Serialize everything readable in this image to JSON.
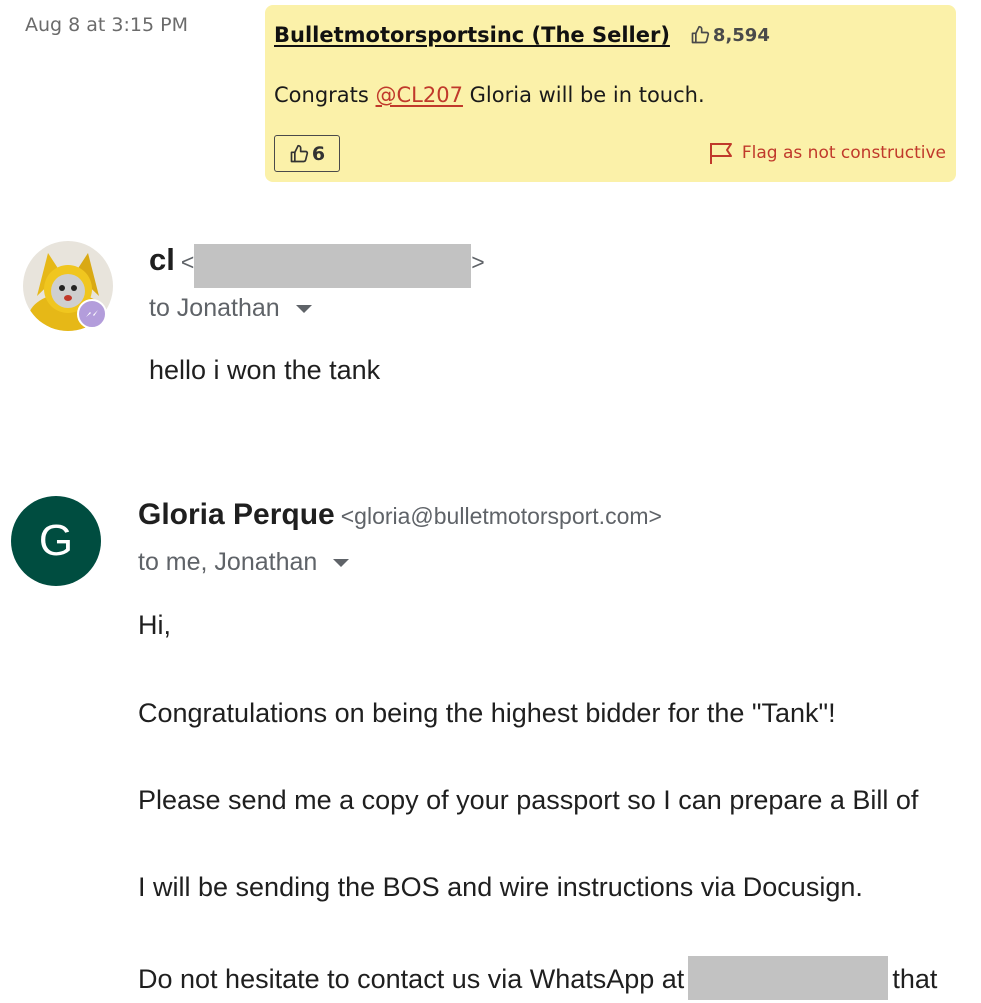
{
  "comment": {
    "date": "Aug 8 at 3:15 PM",
    "author": "Bulletmotorsportsinc (The Seller)",
    "karma": "8,594",
    "text_before": "Congrats ",
    "mention": "@CL207",
    "text_after": " Gloria will be in touch.",
    "likes": "6",
    "flag_label": "Flag as not constructive",
    "colors": {
      "box_background": "#fbf1a9",
      "accent_red": "#c0392b"
    }
  },
  "email1": {
    "sender_name": "cl",
    "email_open": "<",
    "email_close": ">",
    "recipients": "to Jonathan",
    "body": "hello i won the tank"
  },
  "email2": {
    "avatar_letter": "G",
    "avatar_color": "#004d40",
    "sender_name": "Gloria Perque",
    "sender_email": "<gloria@bulletmotorsport.com>",
    "recipients": "to me, Jonathan",
    "lines": [
      "Hi,",
      "Congratulations on being the highest bidder for the \"Tank\"!",
      "Please send me a copy of your passport so I can prepare a Bill of",
      "I will be sending the BOS and wire instructions via Docusign.",
      "Do not hesitate to contact us via WhatsApp at"
    ],
    "line5_tail": "that"
  },
  "icons": {
    "thumbs_up": "thumbs-up-icon",
    "flag": "flag-icon",
    "caret": "chevron-down-icon",
    "badge": "messenger-badge-icon"
  }
}
